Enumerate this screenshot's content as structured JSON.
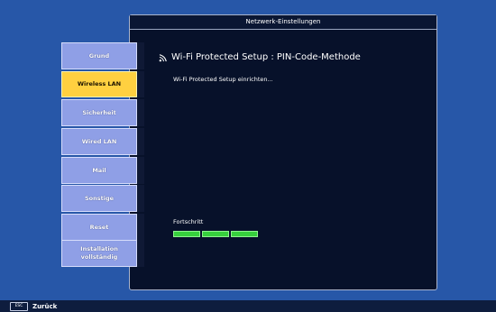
{
  "window": {
    "title": "Netzwerk-Einstellungen"
  },
  "sidebar": {
    "items": [
      {
        "label": "Grund",
        "active": false
      },
      {
        "label": "Wireless LAN",
        "active": true
      },
      {
        "label": "Sicherheit",
        "active": false
      },
      {
        "label": "Wired LAN",
        "active": false
      },
      {
        "label": "Mail",
        "active": false
      },
      {
        "label": "Sonstige",
        "active": false
      },
      {
        "label": "Reset",
        "active": false
      },
      {
        "label": "Installation\nvollständig",
        "active": false
      }
    ]
  },
  "main": {
    "heading": "Wi-Fi Protected Setup : PIN-Code-Methode",
    "heading_icon": "wifi-icon",
    "status": "Wi-Fi Protected Setup einrichten...",
    "progress_label": "Fortschritt",
    "progress_segments_filled": 3
  },
  "footer": {
    "key": "ESC",
    "label": "Zurück"
  },
  "colors": {
    "background": "#2757a8",
    "panel": "#07112a",
    "nav_button": "#8f9fe6",
    "nav_active": "#ffd040",
    "progress": "#37d03d"
  }
}
